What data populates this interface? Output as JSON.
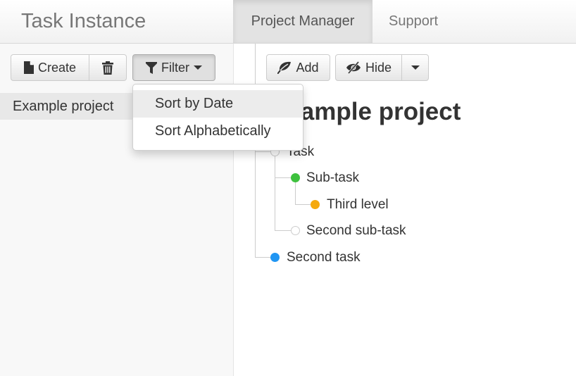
{
  "navbar": {
    "brand": "Task Instance",
    "tabs": [
      {
        "label": "Project Manager",
        "active": true
      },
      {
        "label": "Support",
        "active": false
      }
    ]
  },
  "sidebar": {
    "toolbar": {
      "create_label": "Create",
      "create_icon": "file-icon",
      "delete_icon": "trash-icon",
      "filter_label": "Filter",
      "filter_icon": "funnel-icon"
    },
    "filter_menu": {
      "items": [
        "Sort by Date",
        "Sort Alphabetically"
      ],
      "highlighted": "Sort by Date"
    },
    "projects": [
      {
        "label": "Example project",
        "selected": true
      }
    ]
  },
  "main": {
    "toolbar": {
      "add_label": "Add",
      "add_icon": "leaf-icon",
      "hide_label": "Hide",
      "hide_icon": "eye-slash-icon"
    },
    "title": "Example project",
    "tasks": [
      {
        "label": "Task",
        "status_color": "#ffffff",
        "level": 1
      },
      {
        "label": "Sub-task",
        "status_color": "#3ec13e",
        "level": 2
      },
      {
        "label": "Third level",
        "status_color": "#f5a90d",
        "level": 3
      },
      {
        "label": "Second sub-task",
        "status_color": "#ffffff",
        "level": 2
      },
      {
        "label": "Second task",
        "status_color": "#2196f3",
        "level": 1
      }
    ]
  },
  "colors": {
    "green_status": "#3ec13e",
    "orange_status": "#f5a90d",
    "blue_status": "#2196f3",
    "empty_status": "#ffffff"
  }
}
